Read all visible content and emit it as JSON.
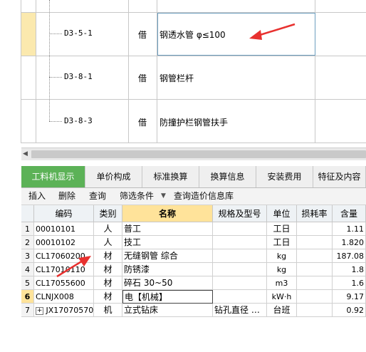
{
  "upper_grid": {
    "rows": [
      {
        "code": "",
        "type": "",
        "name": ""
      },
      {
        "code": "D3-5-1",
        "type": "借",
        "name": "钢透水管 φ≤100"
      },
      {
        "code": "D3-8-1",
        "type": "借",
        "name": "钢管栏杆"
      },
      {
        "code": "D3-8-3",
        "type": "借",
        "name": "防撞护栏钢管扶手"
      }
    ]
  },
  "tabs": [
    {
      "label": "工料机显示"
    },
    {
      "label": "单价构成"
    },
    {
      "label": "标准换算"
    },
    {
      "label": "换算信息"
    },
    {
      "label": "安装费用"
    },
    {
      "label": "特征及内容"
    }
  ],
  "toolbar": {
    "insert": "插入",
    "delete": "删除",
    "query": "查询",
    "filter": "筛选条件",
    "query_price_lib": "查询造价信息库"
  },
  "table": {
    "headers": {
      "code": "编码",
      "cat": "类别",
      "name": "名称",
      "spec": "规格及型号",
      "unit": "单位",
      "loss": "损耗率",
      "qty": "含量"
    },
    "rows": [
      {
        "no": "1",
        "code": "00010101",
        "cat": "人",
        "name": "普工",
        "spec": "",
        "unit": "工日",
        "loss": "",
        "qty": "1.11"
      },
      {
        "no": "2",
        "code": "00010102",
        "cat": "人",
        "name": "技工",
        "spec": "",
        "unit": "工日",
        "loss": "",
        "qty": "1.820"
      },
      {
        "no": "3",
        "code": "CL17060200",
        "cat": "材",
        "name": "无缝钢管 综合",
        "spec": "",
        "unit": "kg",
        "loss": "",
        "qty": "187.08"
      },
      {
        "no": "4",
        "code": "CL17010110",
        "cat": "材",
        "name": "防锈漆",
        "spec": "",
        "unit": "kg",
        "loss": "",
        "qty": "1.8"
      },
      {
        "no": "5",
        "code": "CL17055600",
        "cat": "材",
        "name": "碎石 30~50",
        "spec": "",
        "unit": "m3",
        "loss": "",
        "qty": "1.6"
      },
      {
        "no": "6",
        "code": "CLNJX008",
        "cat": "材",
        "name": "电【机械】",
        "spec": "",
        "unit": "kW·h",
        "loss": "",
        "qty": "9.17"
      },
      {
        "no": "7",
        "code": "JX17070570",
        "cat": "机",
        "name": "立式钻床",
        "spec": "钻孔直径 …",
        "unit": "台班",
        "loss": "",
        "qty": "0.92"
      }
    ]
  },
  "colors": {
    "accent": "#5cb257",
    "highlight": "#ffe39a",
    "annotation": "#e8312f"
  }
}
